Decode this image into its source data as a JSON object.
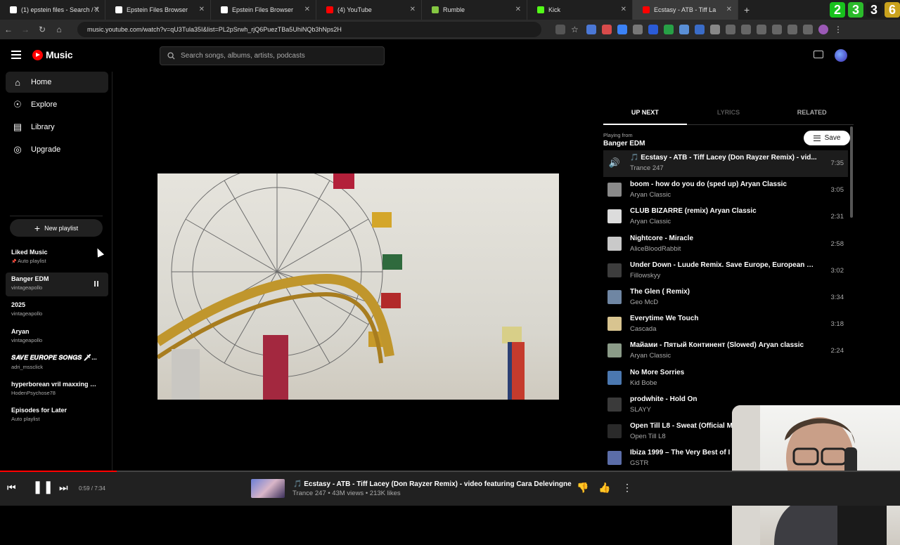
{
  "browser": {
    "tabs": [
      {
        "label": "(1) epstein files - Search / X",
        "icon": "x-logo-icon",
        "color": "#ffffff"
      },
      {
        "label": "Epstein Files Browser",
        "icon": "triangle-icon",
        "color": "#ffffff"
      },
      {
        "label": "Epstein Files Browser",
        "icon": "triangle-icon",
        "color": "#ffffff"
      },
      {
        "label": "(4) YouTube",
        "icon": "youtube-icon",
        "color": "#ff0000"
      },
      {
        "label": "Rumble",
        "icon": "rumble-icon",
        "color": "#85c742"
      },
      {
        "label": "Kick",
        "icon": "kick-icon",
        "color": "#53fc18"
      },
      {
        "label": "Ecstasy - ATB - Tiff La",
        "icon": "youtube-music-icon",
        "color": "#ff0000"
      }
    ],
    "new_tab": "+",
    "overlay": [
      "2",
      "3",
      "3",
      "6"
    ],
    "url": "music.youtube.com/watch?v=qU3Tula35I&list=PL2pSrwh_rjQ6PuezTBa5UhiNQb3hNps2H"
  },
  "app": {
    "logo_text": "Music",
    "search_placeholder": "Search songs, albums, artists, podcasts"
  },
  "nav": [
    {
      "label": "Home",
      "icon": "home-icon",
      "active": true
    },
    {
      "label": "Explore",
      "icon": "compass-icon"
    },
    {
      "label": "Library",
      "icon": "library-icon"
    },
    {
      "label": "Upgrade",
      "icon": "upgrade-icon"
    }
  ],
  "new_playlist": "New playlist",
  "playlists": [
    {
      "title": "Liked Music",
      "sub": "Auto playlist",
      "pinned": true
    },
    {
      "title": "Banger EDM",
      "sub": "vintageapollo",
      "active": true
    },
    {
      "title": "2025",
      "sub": "vintageapollo"
    },
    {
      "title": "Aryan",
      "sub": "vintageapollo"
    },
    {
      "title": "𝑺𝑨𝑽𝑬 𝑬𝑼𝑹𝑶𝑷𝑬 𝑺𝑶𝑵𝑮𝑺 🗡...",
      "sub": "adri_mssclick"
    },
    {
      "title": "hyperborean vril maxxing pla...",
      "sub": "HodenPsychose78"
    },
    {
      "title": "Episodes for Later",
      "sub": "Auto playlist"
    }
  ],
  "panel": {
    "tabs": [
      "UP NEXT",
      "LYRICS",
      "RELATED"
    ],
    "playing_from_label": "Playing from",
    "playing_from": "Banger EDM",
    "save_label": "Save",
    "tracks": [
      {
        "title": "🎵 Ecstasy - ATB - Tiff Lacey (Don Rayzer Remix) - vid...",
        "artist": "Trance 247",
        "duration": "7:35",
        "active": true,
        "thumb": "#1c1c1c"
      },
      {
        "title": "boom - how do you do (sped up) Aryan Classic",
        "artist": "Aryan Classic",
        "duration": "3:05",
        "thumb": "#8a8a8a"
      },
      {
        "title": "CLUB BIZARRE (remix) Aryan Classic",
        "artist": "Aryan Classic",
        "duration": "2:31",
        "thumb": "#dcdcdc"
      },
      {
        "title": "Nightcore - Miracle",
        "artist": "AliceBloodRabbit",
        "duration": "2:58",
        "thumb": "#c9c9c9"
      },
      {
        "title": "Under Down - Luude Remix. Save Europe, European Cl...",
        "artist": "Fillowskyy",
        "duration": "3:02",
        "thumb": "#3d3d3d"
      },
      {
        "title": "The Glen ( Remix)",
        "artist": "Geo McD",
        "duration": "3:34",
        "thumb": "#6f86a3"
      },
      {
        "title": "Everytime We Touch",
        "artist": "Cascada",
        "duration": "3:18",
        "thumb": "#d8c490"
      },
      {
        "title": "Майами - Пятый Континент (Slowed) Aryan classic",
        "artist": "Aryan Classic",
        "duration": "2:24",
        "thumb": "#8b9b88"
      },
      {
        "title": "No More Sorries",
        "artist": "Kid Bobe",
        "duration": "",
        "thumb": "#4b78b0"
      },
      {
        "title": "prodwhite - Hold On",
        "artist": "SLAYY",
        "duration": "",
        "thumb": "#3a3a3a"
      },
      {
        "title": "Open Till L8 - Sweat (Official M",
        "artist": "Open Till L8",
        "duration": "",
        "thumb": "#2a2a2a"
      },
      {
        "title": "Ibiza 1999 – The Very Best of I",
        "artist": "GSTR",
        "duration": "",
        "thumb": "#5b6da8"
      }
    ]
  },
  "player": {
    "time": "0:59 / 7:34",
    "progress": 0.13,
    "title": "🎵 Ecstasy - ATB - Tiff Lacey (Don Rayzer Remix) - video featuring Cara Delevingne",
    "sub": "Trance 247 • 43M views • 213K likes"
  }
}
